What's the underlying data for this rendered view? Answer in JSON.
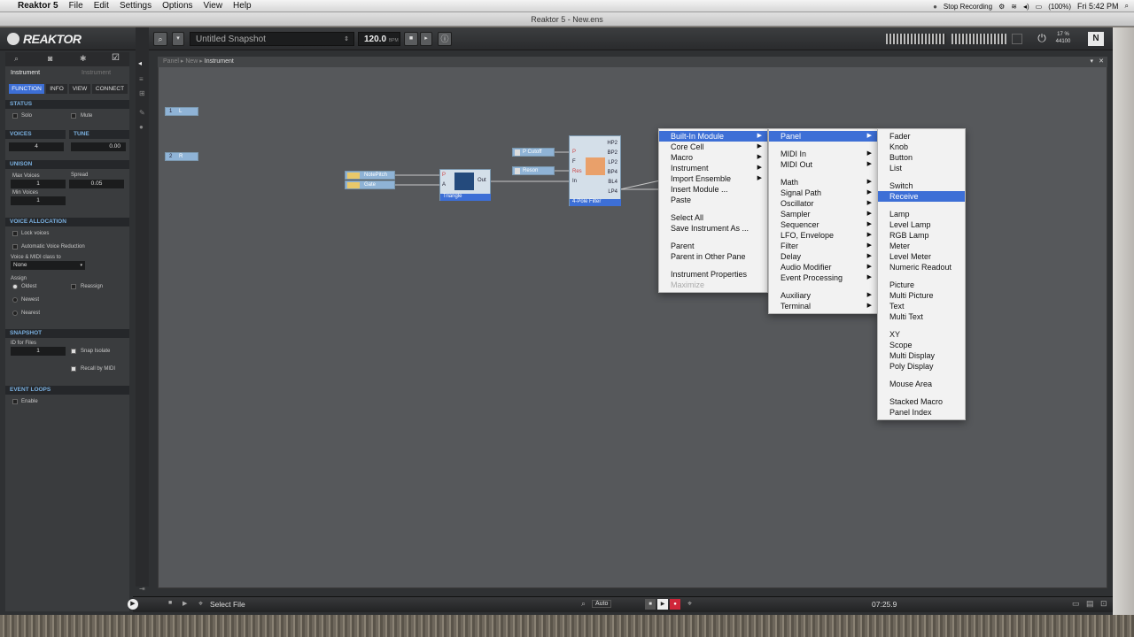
{
  "menubar": {
    "app": "Reaktor 5",
    "items": [
      "File",
      "Edit",
      "Settings",
      "Options",
      "View",
      "Help"
    ],
    "stop_recording": "Stop Recording",
    "battery": "(100%)",
    "clock": "Fri 5:42 PM"
  },
  "window": {
    "title": "Reaktor 5 - New.ens"
  },
  "header": {
    "logo": "REAKTOR",
    "snapshot": "Untitled Snapshot",
    "tempo": "120.0",
    "tempo_unit": "BPM",
    "cpu": "17 %",
    "rate": "44100"
  },
  "sidebar": {
    "instrument_name": "Instrument",
    "instrument_type": "Instrument",
    "tabs": [
      "FUNCTION",
      "INFO",
      "VIEW",
      "CONNECT"
    ],
    "status": {
      "title": "STATUS",
      "solo": "Solo",
      "mute": "Mute"
    },
    "voices": {
      "title": "VOICES",
      "value": "4"
    },
    "tune": {
      "title": "TUNE",
      "value": "0.00"
    },
    "unison": {
      "title": "UNISON",
      "max_voices_label": "Max Voices",
      "max_voices": "1",
      "spread_label": "Spread",
      "spread": "0.05",
      "min_voices_label": "Min Voices",
      "min_voices": "1"
    },
    "voice_allocation": {
      "title": "VOICE ALLOCATION",
      "lock": "Lock voices",
      "auto": "Automatic Voice Reduction",
      "midi_label": "Voice & MIDI class to",
      "midi_value": "None",
      "assign_label": "Assign",
      "oldest": "Oldest",
      "reassign": "Reassign",
      "newest": "Newest",
      "nearest": "Nearest"
    },
    "snapshot": {
      "title": "SNAPSHOT",
      "id_label": "ID for Files",
      "id_value": "1",
      "snap_isolate": "Snap Isolate",
      "recall_midi": "Recall by MIDI"
    },
    "event_loops": {
      "title": "EVENT LOOPS",
      "enable": "Enable"
    }
  },
  "breadcrumb": [
    "Panel",
    "New",
    "Instrument"
  ],
  "modules": {
    "in_l": "L",
    "in_r": "R",
    "in_l_num": "1",
    "in_r_num": "2",
    "notepitch": "NotePitch",
    "gate": "Gate",
    "osc_name": "Triangle",
    "osc_out": "Out",
    "osc_p": "P",
    "osc_a": "A",
    "pcutoff": "P Cutoff",
    "reson": "Reson",
    "filter_name": "4-Pole Filter",
    "filter_in": [
      "P",
      "F",
      "Res",
      "In"
    ],
    "filter_out": [
      "HP2",
      "BP2",
      "LP2",
      "BP4",
      "BL4",
      "LP4"
    ]
  },
  "context_menu": {
    "main": [
      {
        "label": "Built-In Module",
        "sub": true,
        "selected": true
      },
      {
        "label": "Core Cell",
        "sub": true
      },
      {
        "label": "Macro",
        "sub": true
      },
      {
        "label": "Instrument",
        "sub": true
      },
      {
        "label": "Import Ensemble",
        "sub": true
      },
      {
        "label": "Insert Module ..."
      },
      {
        "label": "Paste"
      },
      {
        "sep": true
      },
      {
        "label": "Select All"
      },
      {
        "label": "Save Instrument As ..."
      },
      {
        "sep": true
      },
      {
        "label": "Parent"
      },
      {
        "label": "Parent in Other Pane"
      },
      {
        "sep": true
      },
      {
        "label": "Instrument Properties"
      },
      {
        "label": "Maximize",
        "disabled": true
      }
    ],
    "builtin": [
      {
        "label": "Panel",
        "sub": true,
        "selected": true
      },
      {
        "sep": true
      },
      {
        "label": "MIDI In",
        "sub": true
      },
      {
        "label": "MIDI Out",
        "sub": true
      },
      {
        "sep": true
      },
      {
        "label": "Math",
        "sub": true
      },
      {
        "label": "Signal Path",
        "sub": true
      },
      {
        "label": "Oscillator",
        "sub": true
      },
      {
        "label": "Sampler",
        "sub": true
      },
      {
        "label": "Sequencer",
        "sub": true
      },
      {
        "label": "LFO, Envelope",
        "sub": true
      },
      {
        "label": "Filter",
        "sub": true
      },
      {
        "label": "Delay",
        "sub": true
      },
      {
        "label": "Audio Modifier",
        "sub": true
      },
      {
        "label": "Event Processing",
        "sub": true
      },
      {
        "sep": true
      },
      {
        "label": "Auxiliary",
        "sub": true
      },
      {
        "label": "Terminal",
        "sub": true
      }
    ],
    "panel": [
      {
        "label": "Fader"
      },
      {
        "label": "Knob"
      },
      {
        "label": "Button"
      },
      {
        "label": "List"
      },
      {
        "sep": true
      },
      {
        "label": "Switch"
      },
      {
        "label": "Receive",
        "selected": true
      },
      {
        "sep": true
      },
      {
        "label": "Lamp"
      },
      {
        "label": "Level Lamp"
      },
      {
        "label": "RGB Lamp"
      },
      {
        "label": "Meter"
      },
      {
        "label": "Level Meter"
      },
      {
        "label": "Numeric Readout"
      },
      {
        "sep": true
      },
      {
        "label": "Picture"
      },
      {
        "label": "Multi Picture"
      },
      {
        "label": "Text"
      },
      {
        "label": "Multi Text"
      },
      {
        "sep": true
      },
      {
        "label": "XY"
      },
      {
        "label": "Scope"
      },
      {
        "label": "Multi Display"
      },
      {
        "label": "Poly Display"
      },
      {
        "sep": true
      },
      {
        "label": "Mouse Area"
      },
      {
        "sep": true
      },
      {
        "label": "Stacked Macro"
      },
      {
        "label": "Panel Index"
      }
    ]
  },
  "bottom": {
    "file": "Select File",
    "auto": "Auto",
    "time": "07:25.9"
  },
  "colors": {
    "accent": "#3d6fd6",
    "panel": "#56585b",
    "sidebar_head": "#7ab0e0",
    "record": "#d0263a"
  }
}
